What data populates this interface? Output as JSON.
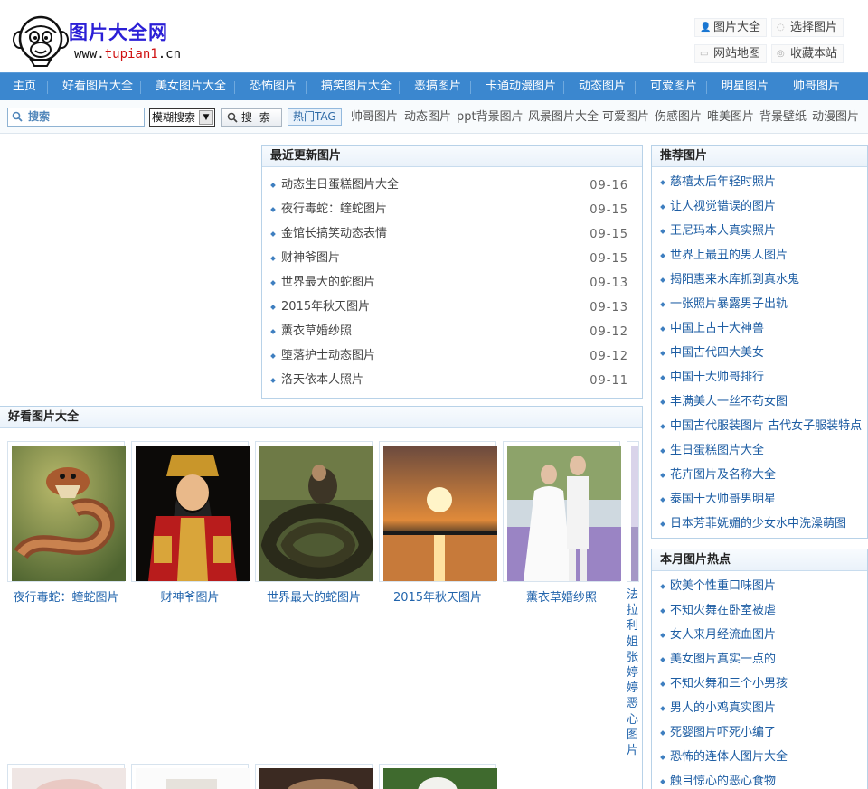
{
  "header": {
    "logo_title": "图片大全网",
    "logo_url_prefix": "www.",
    "logo_url_brand": "tupian1",
    "logo_url_suffix": ".cn",
    "top_links": [
      {
        "label": "图片大全",
        "icon": "user-icon"
      },
      {
        "label": "选择图片",
        "icon": "chat-icon"
      },
      {
        "label": "网站地图",
        "icon": "map-icon"
      },
      {
        "label": "收藏本站",
        "icon": "star-icon"
      }
    ]
  },
  "nav": {
    "items": [
      "主页",
      "好看图片大全",
      "美女图片大全",
      "恐怖图片",
      "搞笑图片大全",
      "恶搞图片",
      "卡通动漫图片",
      "动态图片",
      "可爱图片",
      "明星图片",
      "帅哥图片"
    ]
  },
  "search": {
    "placeholder": "搜索",
    "mode_selected": "模糊搜索",
    "button_label": "搜 索",
    "tag_label": "热门TAG",
    "tags": [
      "帅哥图片",
      "动态图片",
      "ppt背景图片",
      "风景图片大全",
      "可爱图片",
      "伤感图片",
      "唯美图片",
      "背景壁纸",
      "动漫图片"
    ]
  },
  "recent": {
    "title": "最近更新图片",
    "items": [
      {
        "title": "动态生日蛋糕图片大全",
        "date": "09-16"
      },
      {
        "title": "夜行毒蛇：蝰蛇图片",
        "date": "09-15"
      },
      {
        "title": "金馆长搞笑动态表情",
        "date": "09-15"
      },
      {
        "title": "财神爷图片",
        "date": "09-15"
      },
      {
        "title": "世界最大的蛇图片",
        "date": "09-13"
      },
      {
        "title": "2015年秋天图片",
        "date": "09-13"
      },
      {
        "title": "薰衣草婚纱照",
        "date": "09-12"
      },
      {
        "title": "堕落护士动态图片",
        "date": "09-12"
      },
      {
        "title": "洛天依本人照片",
        "date": "09-11"
      }
    ]
  },
  "recommend": {
    "title": "推荐图片",
    "items": [
      "慈禧太后年轻时照片",
      "让人视觉错误的图片",
      "王尼玛本人真实照片",
      "世界上最丑的男人图片",
      "揭阳惠来水库抓到真水鬼",
      "一张照片暴露男子出轨",
      "中国上古十大神兽",
      "中国古代四大美女",
      "中国十大帅哥排行",
      "丰满美人一丝不苟女图",
      "中国古代服装图片 古代女子服装特点",
      "生日蛋糕图片大全",
      "花卉图片及名称大全",
      "泰国十大帅哥男明星",
      "日本芳菲妩媚的少女水中洗澡萌图"
    ]
  },
  "monthly": {
    "title": "本月图片热点",
    "items": [
      "欧美个性重口味图片",
      "不知火舞在卧室被虐",
      "女人来月经流血图片",
      "美女图片真实一点的",
      "不知火舞和三个小男孩",
      "男人的小鸡真实图片",
      "死婴图片吓死小编了",
      "恐怖的连体人图片大全",
      "触目惊心的恶心食物"
    ]
  },
  "gallery": {
    "title": "好看图片大全",
    "cards": [
      {
        "caption": "夜行毒蛇：蝰蛇图片",
        "image": "viper-snake-image"
      },
      {
        "caption": "财神爷图片",
        "image": "god-of-wealth-statue-image"
      },
      {
        "caption": "世界最大的蛇图片",
        "image": "anaconda-image"
      },
      {
        "caption": "2015年秋天图片",
        "image": "sunset-lake-image"
      },
      {
        "caption": "薰衣草婚纱照",
        "image": "lavender-wedding-image"
      },
      {
        "caption": "法拉利姐张婷婷恶心图片",
        "image": "partial-photo-image"
      }
    ],
    "second_row": [
      "flower-image",
      "cup-image",
      "brown-image",
      "lotus-leaf-image"
    ]
  },
  "colors": {
    "nav_bg": "#3b87cf",
    "link_blue": "#1d5da3",
    "logo_purple": "#2b1fd6",
    "box_border": "#b8d2e8"
  }
}
